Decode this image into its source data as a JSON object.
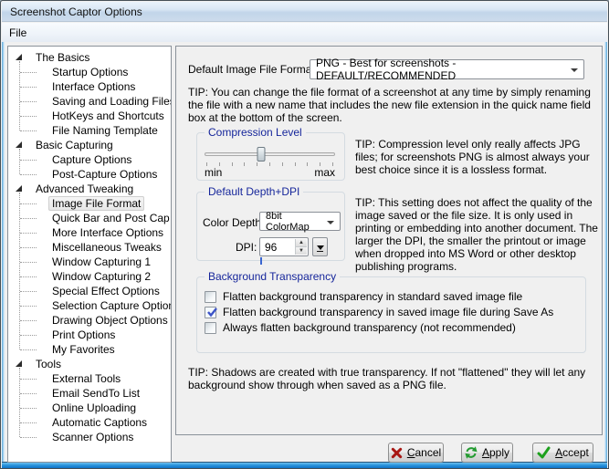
{
  "window": {
    "title": "Screenshot Captor Options"
  },
  "menu": {
    "items": [
      {
        "label": "File"
      }
    ]
  },
  "tree": {
    "selected": "Image File Format",
    "sections": [
      {
        "label": "The Basics",
        "children": [
          "Startup Options",
          "Interface Options",
          "Saving and Loading Files",
          "HotKeys and Shortcuts",
          "File Naming Template"
        ]
      },
      {
        "label": "Basic Capturing",
        "children": [
          "Capture Options",
          "Post-Capture Options"
        ]
      },
      {
        "label": "Advanced Tweaking",
        "children": [
          "Image File Format",
          "Quick Bar and Post Cap",
          "More Interface Options",
          "Miscellaneous Tweaks",
          "Window Capturing 1",
          "Window Capturing 2",
          "Special Effect Options",
          "Selection Capture Options",
          "Drawing Object Options",
          "Print Options",
          "My Favorites"
        ]
      },
      {
        "label": "Tools",
        "children": [
          "External Tools",
          "Email SendTo List",
          "Online Uploading",
          "Automatic Captions",
          "Scanner Options"
        ]
      }
    ]
  },
  "content": {
    "format": {
      "label": "Default Image File Format:",
      "value": "PNG - Best for screenshots - DEFAULT/RECOMMENDED"
    },
    "tip_format": "TIP: You can change the file format of a screenshot at any time by simply renaming the file with a new name that includes the new file extension in the quick name field box at the bottom of the screen.",
    "compression": {
      "group_label": "Compression Level",
      "min_label": "min",
      "max_label": "max",
      "slider_percent": 43,
      "tick_count": 11,
      "tip": "TIP: Compression level only really affects JPG files; for screenshots PNG is almost always your best choice since it is a lossless format."
    },
    "depth_dpi": {
      "group_label": "Default Depth+DPI",
      "color_depth_label": "Color Depth:",
      "color_depth_value": "8bit ColorMap",
      "dpi_label": "DPI:",
      "dpi_value": "96",
      "tip": "TIP:  This setting does not affect the quality of the image saved or the file size.  It is only used in printing or embedding into another document.  The larger the DPI, the smaller the printout or image when dropped into MS Word or other desktop publishing programs."
    },
    "transparency": {
      "group_label": "Background Transparency",
      "options": [
        {
          "label": "Flatten background transparency in standard saved image file",
          "checked": false
        },
        {
          "label": "Flatten background transparency in saved image file during Save As",
          "checked": true
        },
        {
          "label": "Always flatten background transparency (not recommended)",
          "checked": false
        }
      ]
    },
    "tip_shadows": "TIP: Shadows are created with true transparency.  If not \"flattened\" they will let any background show through when saved as a PNG file."
  },
  "buttons": {
    "cancel": {
      "label": "Cancel"
    },
    "apply": {
      "label": "Apply"
    },
    "accept": {
      "label": "Accept"
    }
  },
  "colors": {
    "accent_titlebar": "#c9d9ea",
    "frame_blue": "#0d72c8",
    "group_caption": "#16269b",
    "check_mark": "#3c53c7",
    "cancel_icon": "#a81713",
    "apply_icon": "#249b31",
    "accept_icon": "#1ca01c"
  }
}
